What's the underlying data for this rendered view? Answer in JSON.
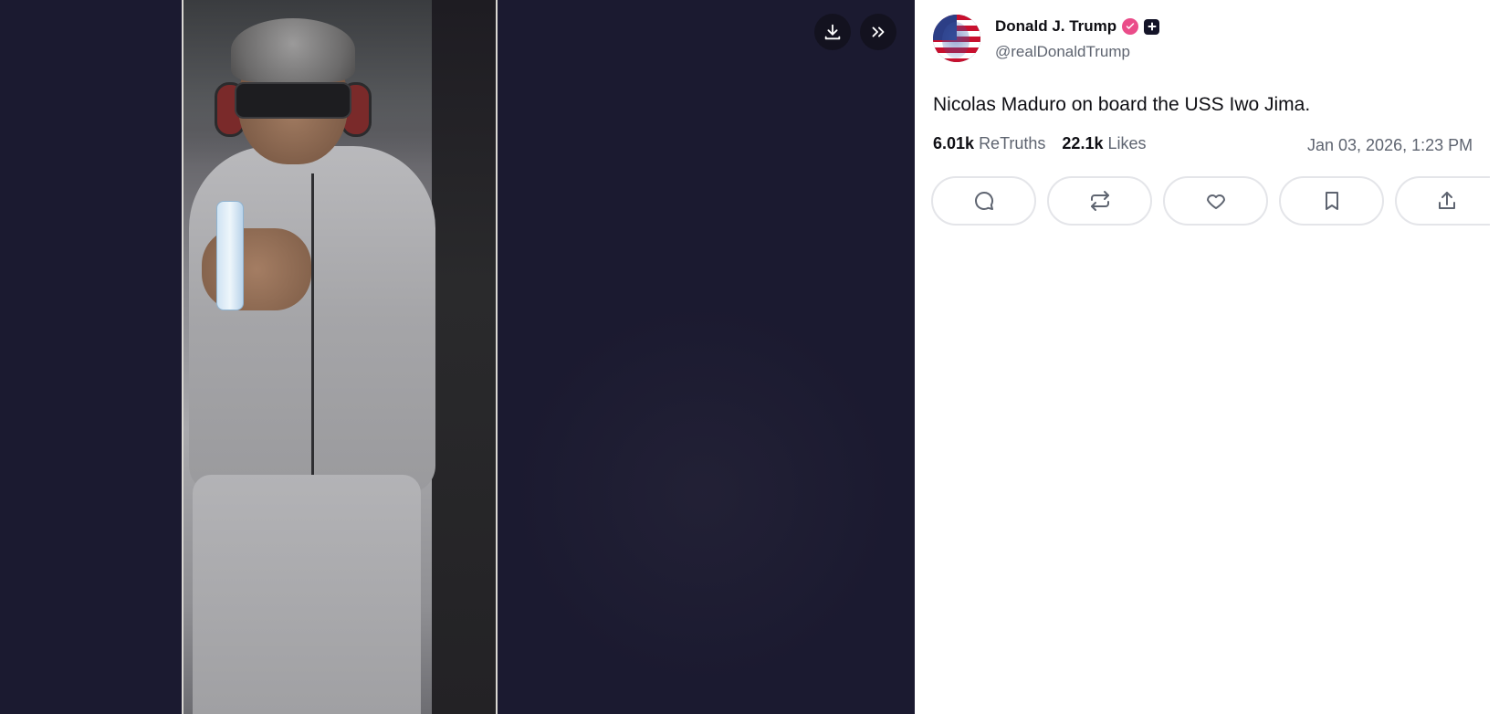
{
  "media": {
    "download_icon": "download-icon",
    "expand_icon": "double-chevron-right-icon",
    "background": "#1b1a30"
  },
  "post": {
    "author": {
      "name": "Donald J. Trump",
      "handle": "@realDonaldTrump",
      "verified_color": "#ea4c89"
    },
    "text": "Nicolas Maduro on board the USS Iwo Jima.",
    "stats": {
      "retruths_count": "6.01k",
      "retruths_label": "ReTruths",
      "likes_count": "22.1k",
      "likes_label": "Likes"
    },
    "timestamp": "Jan 03, 2026, 1:23 PM",
    "actions": [
      {
        "icon": "reply-icon"
      },
      {
        "icon": "retruth-icon"
      },
      {
        "icon": "heart-icon"
      },
      {
        "icon": "bookmark-icon"
      },
      {
        "icon": "share-icon"
      }
    ]
  }
}
